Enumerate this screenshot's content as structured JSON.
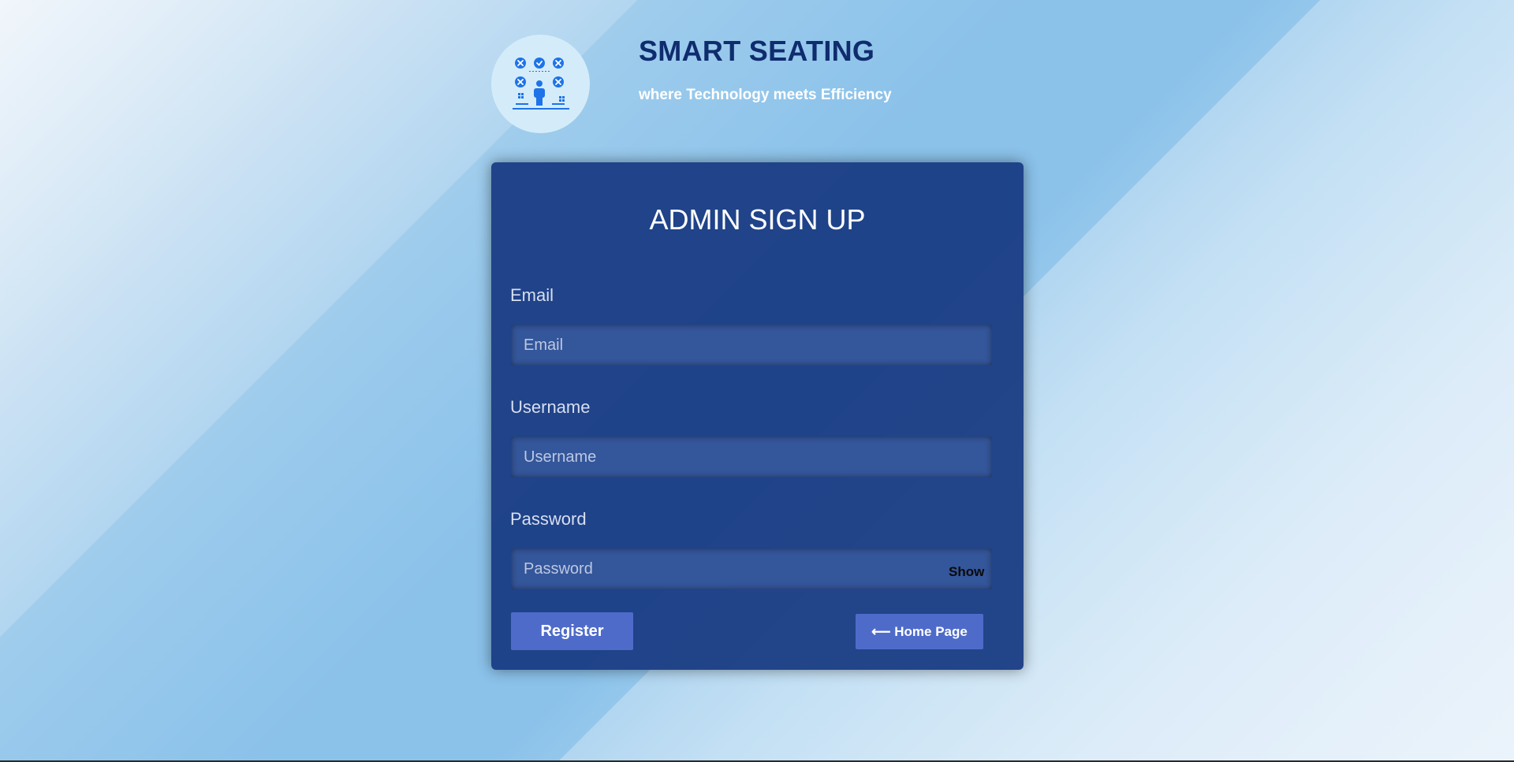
{
  "brand": {
    "title": "SMART SEATING",
    "tagline": "where Technology meets Efficiency",
    "logo_icon": "seating-chart-icon"
  },
  "form": {
    "title": "ADMIN SIGN UP",
    "email": {
      "label": "Email",
      "placeholder": "Email",
      "value": ""
    },
    "username": {
      "label": "Username",
      "placeholder": "Username",
      "value": ""
    },
    "password": {
      "label": "Password",
      "placeholder": "Password",
      "value": "",
      "toggle_label": "Show"
    },
    "register_label": "Register",
    "home_label": "⟵ Home Page"
  },
  "colors": {
    "brand_title": "#0f2c6e",
    "card_background": "#1b3d84",
    "input_background": "#34569a",
    "button": "#4f6bca",
    "logo_circle": "#d4ecf9",
    "logo_icon": "#1e73e8"
  }
}
